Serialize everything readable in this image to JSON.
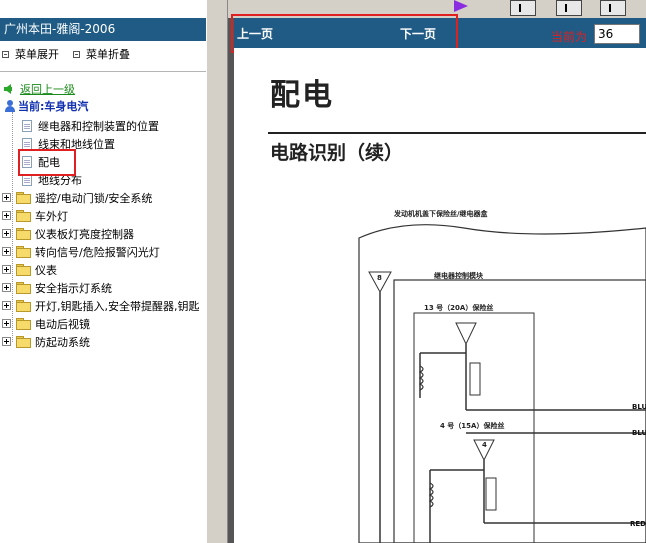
{
  "left_panel": {
    "title": "广州本田-雅阁-2006",
    "menu_expand": "菜单展开",
    "menu_collapse": "菜单折叠",
    "back_link": "返回上一级",
    "current": "当前:车身电汽",
    "doc_items": [
      "继电器和控制装置的位置",
      "线束和地线位置",
      "配电",
      "地线分布"
    ],
    "folder_items": [
      "遥控/电动门锁/安全系统",
      "车外灯",
      "仪表板灯亮度控制器",
      "转向信号/危险报警闪光灯",
      "仪表",
      "安全指示灯系统",
      "开灯,钥匙插入,安全带提醒器,钥匙",
      "电动后视镜",
      "防起动系统"
    ]
  },
  "nav": {
    "prev": "上一页",
    "next": "下一页",
    "current_page_label": "当前为",
    "current_page_value": "36"
  },
  "document": {
    "title": "配电",
    "subtitle": "电路识别（续）",
    "diagram_box_title": "发动机机盖下保险丝/继电器盒",
    "relay_module": "继电器控制模块",
    "fuse_13": "13 号（20A）保险丝",
    "fuse_4": "4 号（15A）保险丝",
    "wire_1": "BLU",
    "wire_2": "BLU",
    "wire_3": "RED",
    "marker_8": "8",
    "marker_4": "4"
  },
  "colors": {
    "title_bar": "#1f5b85",
    "highlight": "#e02020",
    "back_link": "#1a8a1a",
    "current_text": "#1030b0"
  }
}
